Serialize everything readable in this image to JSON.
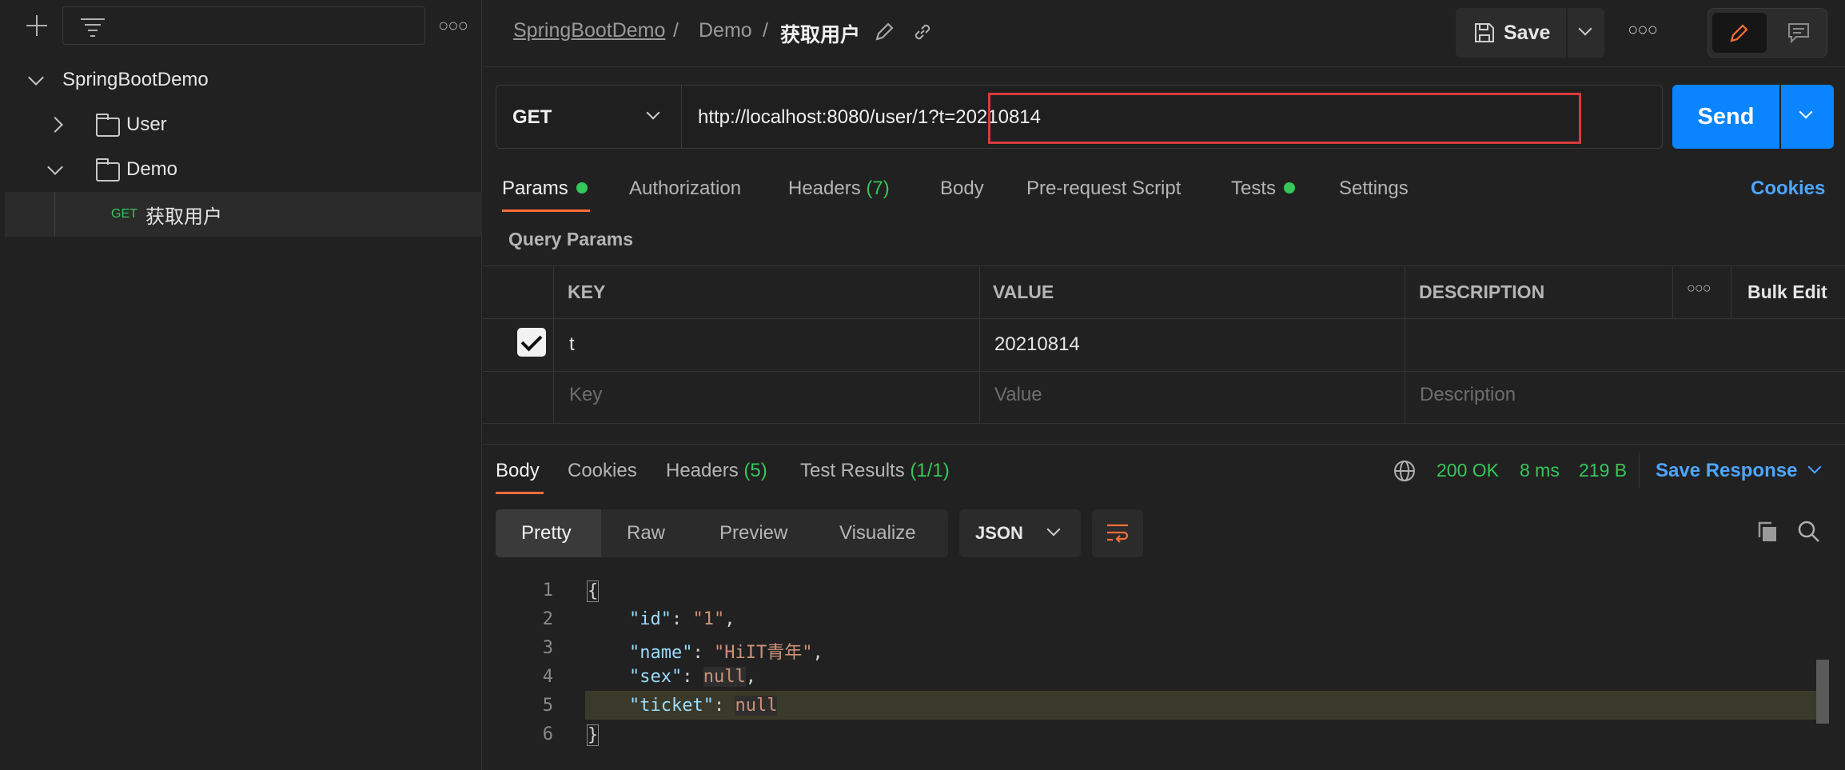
{
  "sidebar": {
    "collection": "SpringBootDemo",
    "folders": [
      "User",
      "Demo"
    ],
    "request": {
      "method": "GET",
      "name": "获取用户"
    }
  },
  "header": {
    "breadcrumb": [
      "SpringBootDemo",
      "Demo",
      "获取用户"
    ],
    "separator": "/",
    "save_label": "Save"
  },
  "request": {
    "method": "GET",
    "url": "http://localhost:8080/user/1?t=20210814",
    "send_label": "Send"
  },
  "tabs": [
    {
      "label": "Params"
    },
    {
      "label": "Authorization"
    },
    {
      "label": "Headers",
      "count": "(7)"
    },
    {
      "label": "Body"
    },
    {
      "label": "Pre-request Script"
    },
    {
      "label": "Tests"
    },
    {
      "label": "Settings"
    }
  ],
  "cookies_label": "Cookies",
  "query_params": {
    "title": "Query Params",
    "columns": [
      "KEY",
      "VALUE",
      "DESCRIPTION"
    ],
    "bulk_edit": "Bulk Edit",
    "rows": [
      {
        "key": "t",
        "value": "20210814",
        "description": ""
      }
    ],
    "placeholders": {
      "key": "Key",
      "value": "Value",
      "description": "Description"
    }
  },
  "response": {
    "tabs": [
      {
        "label": "Body"
      },
      {
        "label": "Cookies"
      },
      {
        "label": "Headers",
        "count": "(5)"
      },
      {
        "label": "Test Results",
        "count": "(1/1)"
      }
    ],
    "status": "200 OK",
    "time": "8 ms",
    "size": "219 B",
    "save_response": "Save Response",
    "formats": [
      "Pretty",
      "Raw",
      "Preview",
      "Visualize"
    ],
    "language": "JSON",
    "line_numbers": [
      "1",
      "2",
      "3",
      "4",
      "5",
      "6"
    ],
    "body": {
      "open": "{",
      "close": "}",
      "id_key": "\"id\"",
      "id_val": "\"1\"",
      "name_key": "\"name\"",
      "name_val": "\"HiIT青年\"",
      "sex_key": "\"sex\"",
      "sex_val": "null",
      "ticket_key": "\"ticket\"",
      "ticket_val": "null"
    }
  },
  "colors": {
    "accent": "#ff6c37",
    "send": "#0a84ff",
    "success": "#34c759",
    "link": "#4da6ff",
    "highlight": "#d93a3a"
  }
}
